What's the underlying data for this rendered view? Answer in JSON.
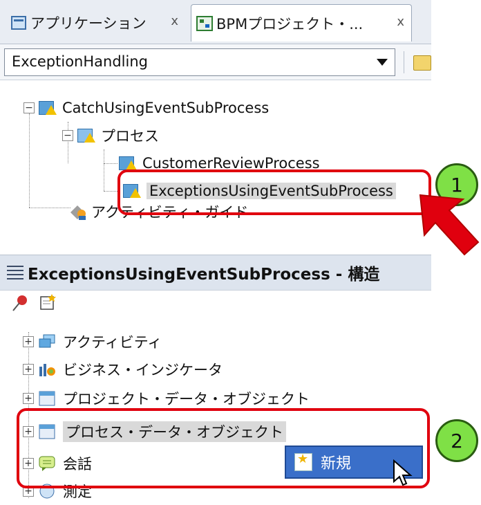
{
  "tabs": [
    {
      "label": "アプリケーション",
      "close": "x"
    },
    {
      "label": "BPMプロジェクト・...",
      "close": "x"
    }
  ],
  "project_selector": {
    "value": "ExceptionHandling"
  },
  "tree_top": {
    "root": "CatchUsingEventSubProcess",
    "process_folder": "プロセス",
    "process1": "CustomerReviewProcess",
    "process2": "ExceptionsUsingEventSubProcess",
    "activity_guide": "アクティビティ・ガイド"
  },
  "structure_panel": {
    "title": "ExceptionsUsingEventSubProcess - 構造"
  },
  "tree_bottom": {
    "items": [
      {
        "label": "アクティビティ"
      },
      {
        "label": "ビジネス・インジケータ"
      },
      {
        "label": "プロジェクト・データ・オブジェクト"
      },
      {
        "label": "プロセス・データ・オブジェクト"
      },
      {
        "label": "会話"
      },
      {
        "label": "測定"
      }
    ]
  },
  "context_menu": {
    "item": "新規"
  },
  "callouts": {
    "one": "1",
    "two": "2"
  },
  "colors": {
    "callout": "#e0000e",
    "badge": "#7fe046",
    "menu_highlight": "#3a6fc9"
  }
}
